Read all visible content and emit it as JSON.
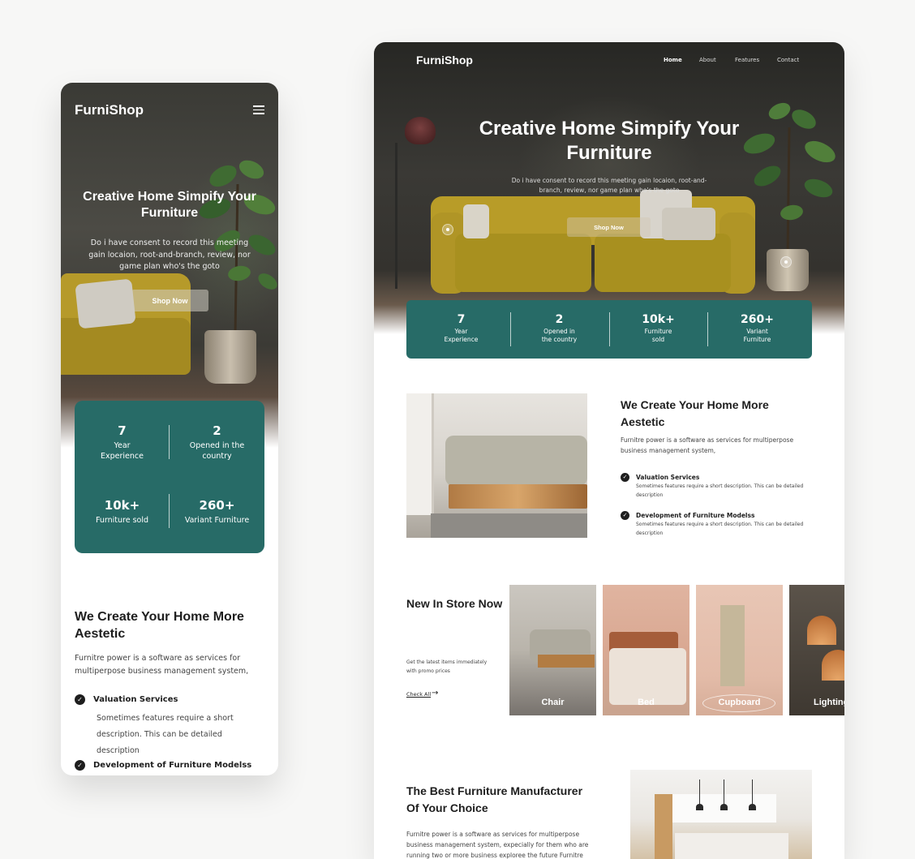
{
  "brand": "FurniShop",
  "nav": [
    "Home",
    "About",
    "Features",
    "Contact"
  ],
  "hero": {
    "title_mobile": "Creative Home Simpify Your Furniture",
    "title_desktop": "Creative Home Simpify Your Furniture",
    "subtitle": "Do i have consent to record this meeting gain locaion, root-and-branch, review, nor game plan who's the goto",
    "cta": "Shop Now"
  },
  "stats": [
    {
      "value": "7",
      "label_mobile": "Year Experience",
      "label_desktop": "Year Experience"
    },
    {
      "value": "2",
      "label_mobile": "Opened in the country",
      "label_desktop": "Opened in the country"
    },
    {
      "value": "10k+",
      "label_mobile": "Furniture sold",
      "label_desktop": "Furniture sold"
    },
    {
      "value": "260+",
      "label_mobile": "Variant Furniture",
      "label_desktop": "Variant Furniture"
    }
  ],
  "about": {
    "title": "We Create Your Home More Aestetic",
    "desc": "Furnitre power is a software as services for multiperpose business management system,",
    "features": [
      {
        "title": "Valuation Services",
        "desc_mobile": "Sometimes features require a short description.  This can be detailed description",
        "desc_desktop": "Sometimes features require a short description.  This can be detailed description"
      },
      {
        "title": "Development of Furniture Modelss",
        "desc_desktop": "Sometimes features require a short description. This can be detailed description"
      }
    ]
  },
  "new_in": {
    "title": "New In Store Now",
    "desc": "Get the latest items immediately with promo prices",
    "check_all": "Check All",
    "categories": [
      "Chair",
      "Bed",
      "Cupboard",
      "Lighting"
    ]
  },
  "best": {
    "title": "The Best Furniture Manufacturer Of Your Choice",
    "desc": "Furnitre power is a software as services for multiperpose business management system, expecially for them who are running two or more business exploree the future Furnitre"
  },
  "colors": {
    "accent": "#276b67",
    "hero_dark": "#2f2e2a",
    "sofa_yellow": "#b89c28"
  },
  "icons": [
    "menu-icon",
    "check-icon",
    "arrow-right-icon"
  ]
}
